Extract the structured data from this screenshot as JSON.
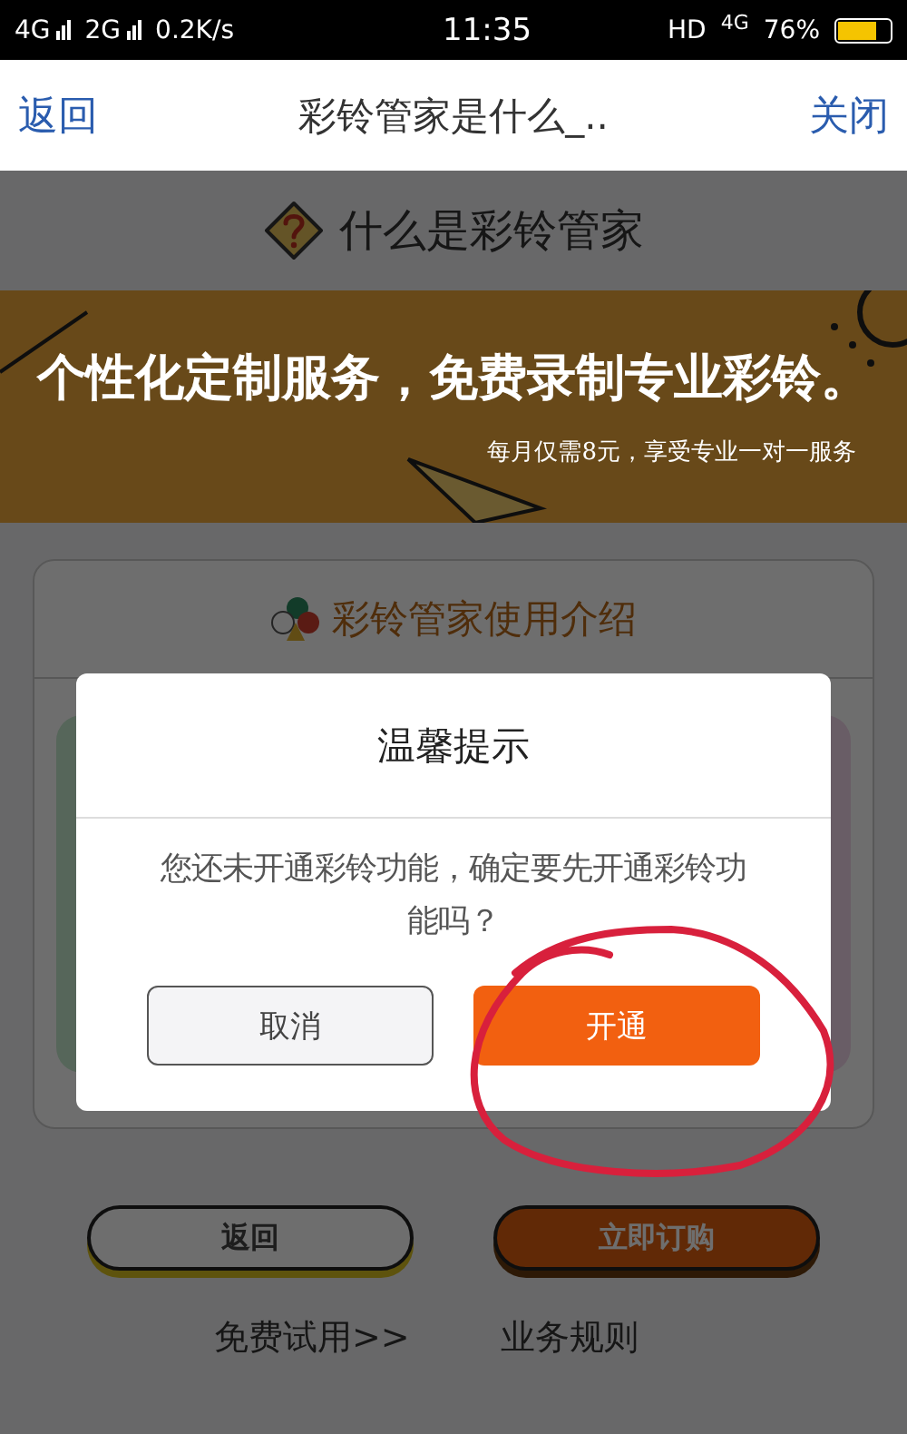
{
  "status_bar": {
    "signal_1": "4G",
    "signal_2": "2G",
    "speed": "0.2K/s",
    "time": "11:35",
    "hd": "HD",
    "network": "4G",
    "battery": "76%"
  },
  "nav": {
    "back": "返回",
    "title": "彩铃管家是什么_..",
    "close": "关闭"
  },
  "page": {
    "heading": "什么是彩铃管家",
    "banner": {
      "headline": "个性化定制服务，免费录制专业彩铃。",
      "subline": "每月仅需8元，享受专业一对一服务"
    },
    "intro_card": {
      "title": "彩铃管家使用介绍"
    },
    "buttons": [
      {
        "label": "返回",
        "kind": "outline"
      },
      {
        "label": "立即订购",
        "kind": "filled"
      }
    ],
    "links": [
      "免费试用>>",
      "业务规则"
    ]
  },
  "dialog": {
    "title": "温馨提示",
    "message": "您还未开通彩铃功能，确定要先开通彩铃功能吗？",
    "buttons": [
      {
        "label": "取消",
        "kind": "secondary"
      },
      {
        "label": "开通",
        "kind": "primary"
      }
    ]
  }
}
